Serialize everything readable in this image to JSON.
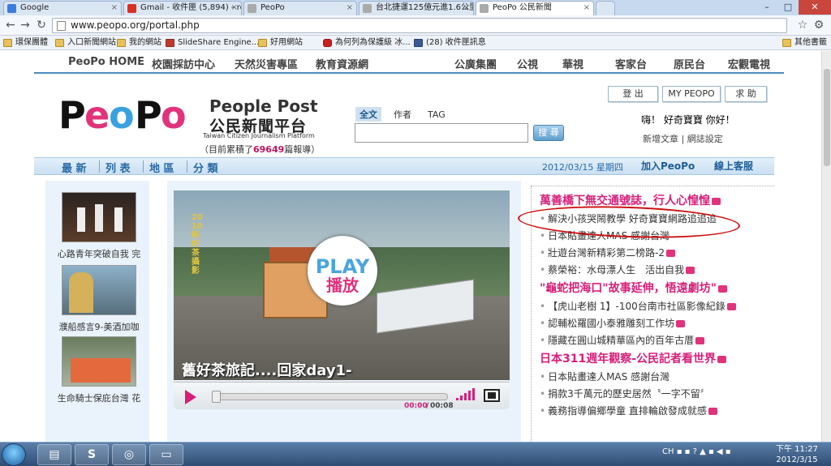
{
  "browser": {
    "tabs": [
      {
        "label": "Google",
        "icon_color": "#3b7ddd"
      },
      {
        "label": "Gmail - 收件匣 (5,894) - rc",
        "icon_color": "#d93025"
      },
      {
        "label": "PeoPo",
        "icon_color": "#888888"
      },
      {
        "label": "台北捷運125億元進1.6公里",
        "icon_color": "#888888"
      },
      {
        "label": "PeoPo 公民新聞",
        "icon_color": "#888888"
      }
    ],
    "url": "www.peopo.org/portal.php",
    "bookmarks": [
      {
        "label": "環保團體",
        "icon": "folder-icon"
      },
      {
        "label": "入口新聞網站",
        "icon": "folder-icon"
      },
      {
        "label": "我的網站",
        "icon": "folder-icon"
      },
      {
        "label": "SlideShare Engine...",
        "icon": "slideshare-icon"
      },
      {
        "label": "好用網站",
        "icon": "folder-icon"
      },
      {
        "label": "為何列為保護級 冰...",
        "icon": "youtube-icon"
      },
      {
        "label": "(28) 收件匣訊息",
        "icon": "facebook-icon"
      },
      {
        "label": "其他書籤",
        "icon": "folder-icon"
      }
    ]
  },
  "site": {
    "topnav": [
      "PeoPo HOME",
      "校園採訪中心",
      "天然災害專區",
      "教育資源網",
      "公廣集團",
      "公視",
      "華視",
      "客家台",
      "原民台",
      "宏觀電視"
    ],
    "logo_text": "PeoPo",
    "title_en": "People Post",
    "title_cn": "公民新聞平台",
    "subtitle_en": "Taiwan Citizen Journalism Platform",
    "count_prefix": "（目前累積了",
    "count_value": "69649",
    "count_suffix": "篇報導）",
    "search_tabs": [
      "全文",
      "作者",
      "TAG"
    ],
    "search_placeholder": "",
    "search_button": "搜 尋",
    "user_buttons": [
      "登 出",
      "MY PEOPO",
      "求 助"
    ],
    "greeting": "嗨！ 好奇寶寶 你好！",
    "user_links": [
      "新增文章",
      "網誌設定"
    ],
    "secnav": [
      "最 新",
      "列 表",
      "地 區",
      "分 類"
    ],
    "date": "2012/03/15 星期四",
    "join_link": "加入PeoPo",
    "service_link": "線上客服"
  },
  "left_items": [
    {
      "caption": "心路青年突破自我 完"
    },
    {
      "caption": "濮船感言9-美酒加咖"
    },
    {
      "caption": "生命騎士保庇台灣 花"
    }
  ],
  "video": {
    "title": "舊好茶旅記....回家day1-",
    "side_text": "2010新好茶攝影",
    "play_label": "PLAY",
    "play_label_cn": "播放",
    "time_current": "00:00",
    "time_separator": "/",
    "time_total": "00:08",
    "progress": 0
  },
  "headlines": [
    {
      "text": "萬善橋下無交通號誌，行人心惶惶",
      "big": true
    },
    {
      "text": "解決小孩哭鬧教學 好奇寶寶網路追追追",
      "big": false
    },
    {
      "text": "日本貼畫達人MAS 感謝台灣",
      "big": false
    },
    {
      "text": "壯遊台灣新精彩第二榜路-2",
      "big": false
    },
    {
      "text": "蔡榮裕：水母漂人生　活出自我",
      "big": false
    },
    {
      "text": "\"龜蛇把海口\"故事延伸，悟遠劇坊\"",
      "big": true
    },
    {
      "text": "【虎山老樹 1】-100台南市社區影像紀錄",
      "big": false
    },
    {
      "text": "認輔松羅國小泰雅雕刻工作坊",
      "big": false
    },
    {
      "text": "隱藏在圓山城精華區內的百年古厝",
      "big": false
    },
    {
      "text": "日本311週年觀察-公民記者看世界",
      "big": true
    },
    {
      "text": "日本貼畫達人MAS 感謝台灣",
      "big": false
    },
    {
      "text": "捐款3千萬元的歷史居然〝一字不留〞",
      "big": false
    },
    {
      "text": "義務指導偏鄉學童 直排輪啟發成就感",
      "big": false
    }
  ],
  "taskbar": {
    "apps": [
      "explorer-icon",
      "skype-icon",
      "chrome-icon",
      "window-icon"
    ],
    "lang": "CH",
    "time": "下午 11:27",
    "date": "2012/3/15"
  },
  "colors": {
    "accent": "#2a6aa5",
    "pink": "#d61f7a",
    "nav_border": "#4a8dbf"
  }
}
